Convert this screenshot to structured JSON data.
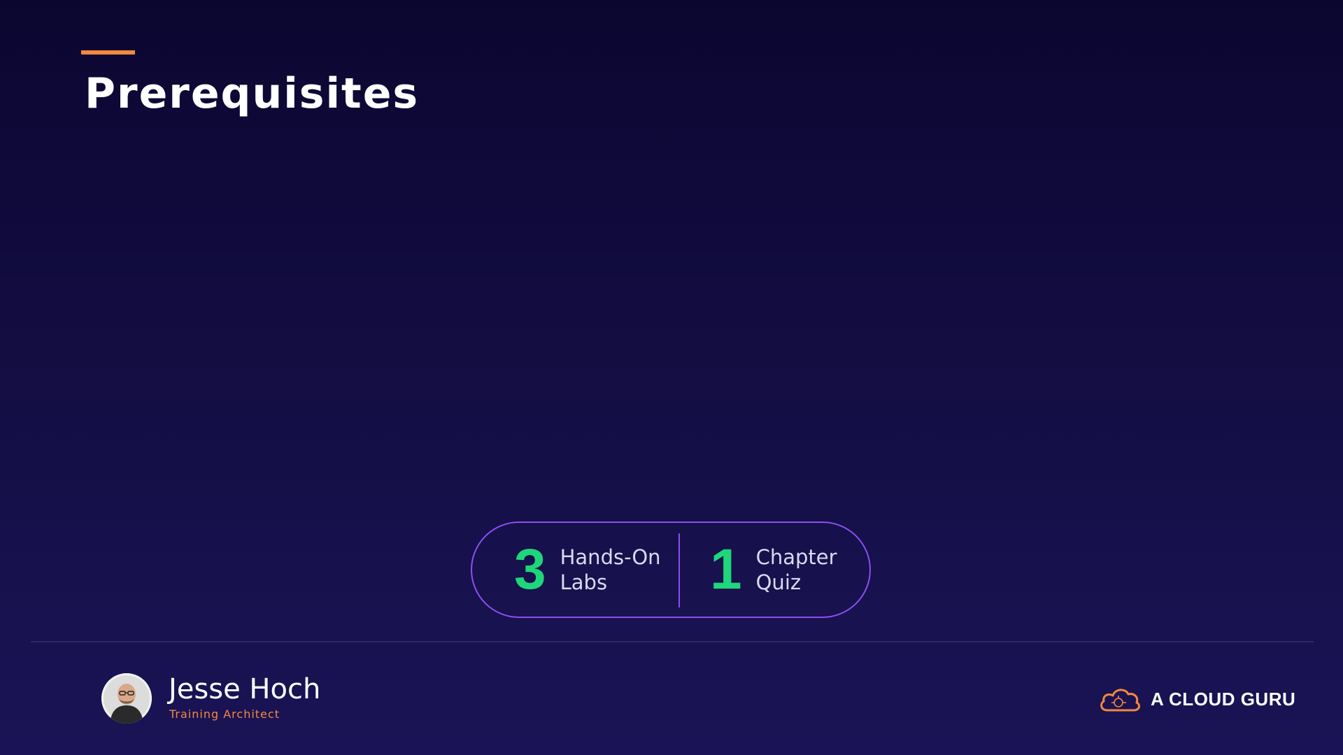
{
  "slide": {
    "title": "Prerequisites"
  },
  "stats": [
    {
      "number": "3",
      "label_line1": "Hands-On",
      "label_line2": "Labs"
    },
    {
      "number": "1",
      "label_line1": "Chapter",
      "label_line2": "Quiz"
    }
  ],
  "presenter": {
    "name": "Jesse Hoch",
    "role": "Training Architect"
  },
  "brand": {
    "name": "A CLOUD GURU",
    "logo_icon": "cloud-icon"
  },
  "colors": {
    "background": "#130d42",
    "accent": "#f5883d",
    "stat_number": "#1fd67a",
    "pill_border": "#8a4ff2"
  }
}
